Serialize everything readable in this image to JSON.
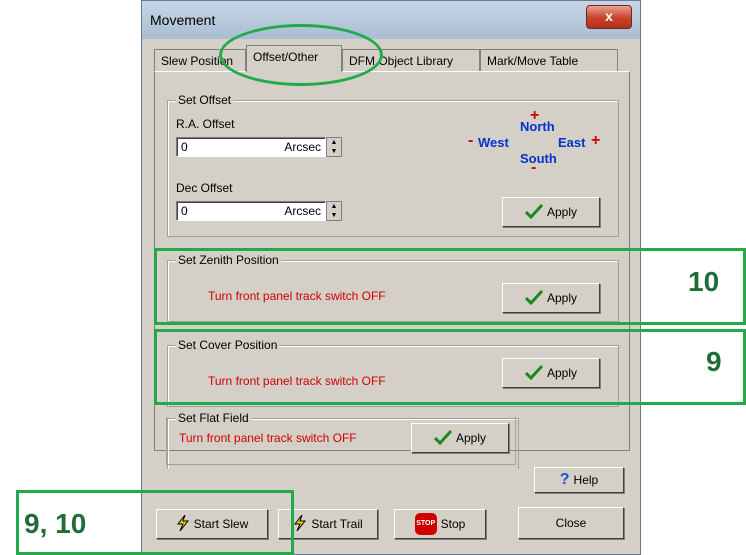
{
  "window": {
    "title": "Movement",
    "close_label": "x"
  },
  "tabs": [
    {
      "label": "Slew Position"
    },
    {
      "label": "Offset/Other"
    },
    {
      "label": "DFM Object Library"
    },
    {
      "label": "Mark/Move Table"
    }
  ],
  "set_offset": {
    "group_label": "Set Offset",
    "ra_label": "R.A. Offset",
    "ra_value": "0",
    "ra_unit": "Arcsec",
    "dec_label": "Dec Offset",
    "dec_value": "0",
    "dec_unit": "Arcsec",
    "compass": {
      "north": "North",
      "south": "South",
      "east": "East",
      "west": "West",
      "plus": "+",
      "minus": "-"
    },
    "apply_label": "Apply"
  },
  "set_zenith": {
    "group_label": "Set Zenith Position",
    "message": "Turn front panel track switch OFF",
    "apply_label": "Apply"
  },
  "set_cover": {
    "group_label": "Set Cover Position",
    "message": "Turn front panel track switch  OFF",
    "apply_label": "Apply"
  },
  "set_flat": {
    "group_label": "Set Flat Field",
    "message": "Turn front panel track switch  OFF",
    "apply_label": "Apply"
  },
  "bottom": {
    "help_label": "Help",
    "start_slew_label": "Start Slew",
    "start_trail_label": "Start Trail",
    "stop_label": "Stop",
    "stop_icon_text": "STOP",
    "close_label": "Close"
  },
  "annotations": {
    "zenith_number": "10",
    "cover_number": "9",
    "slew_number": "9, 10"
  },
  "colors": {
    "annotation": "#22aa4a",
    "warning_text": "#d00000",
    "compass_text": "#0033cc"
  }
}
